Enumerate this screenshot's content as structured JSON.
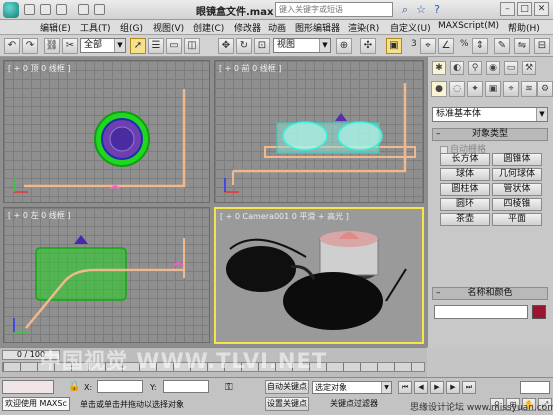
{
  "window": {
    "title": "眼镜盒文件.max",
    "search_placeholder": "键入关键字或短语"
  },
  "menu": [
    "编辑(E)",
    "工具(T)",
    "组(G)",
    "视图(V)",
    "创建(C)",
    "修改器",
    "动画",
    "图形编辑器",
    "渲染(R)",
    "自定义(U)",
    "MAXScript(M)",
    "帮助(H)"
  ],
  "toolbar": {
    "filter_value": "全部",
    "ref_coord_value": "视图",
    "snap_numbers": [
      "3",
      "%"
    ]
  },
  "viewports": {
    "top_label": "[ + 0 顶 0 线框 ]",
    "front_label": "[ + 0 前 0 线框 ]",
    "left_label": "[ + 0 左 0 线框 ]",
    "camera_label": "[ + 0 Camera001 0 平滑 + 高光 ]"
  },
  "command_panel": {
    "category_value": "标准基本体",
    "object_type_title": "对象类型",
    "autogrid_label": "自动栅格",
    "buttons": [
      "长方体",
      "圆锥体",
      "球体",
      "几何球体",
      "圆柱体",
      "管状体",
      "圆环",
      "四棱锥",
      "茶壶",
      "平面"
    ],
    "name_color_title": "名称和颜色",
    "object_color": "#9b1430"
  },
  "timeline": {
    "frame_slider": "0 / 100"
  },
  "watermark": "中国视觉  WWW.TLVI.NET",
  "status": {
    "welcome": "欢迎使用 MAXSc",
    "prompt": "单击或单击并拖动以选择对象",
    "x_label": "X:",
    "y_label": "Y:",
    "auto_key": "自动关键点",
    "set_key": "设置关键点",
    "key_mode_value": "选定对象",
    "key_filters": "关键点过滤器",
    "site": "思缘设计论坛  www.missyuan.com"
  }
}
